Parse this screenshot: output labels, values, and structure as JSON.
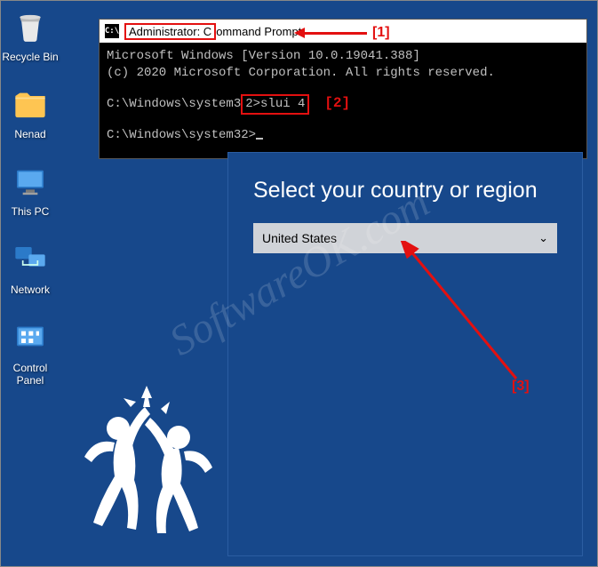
{
  "desktop": {
    "icons": [
      {
        "label": "Recycle Bin"
      },
      {
        "label": "Nenad"
      },
      {
        "label": "This PC"
      },
      {
        "label": "Network"
      },
      {
        "label": "Control Panel"
      }
    ]
  },
  "cmd": {
    "title_prefix": "Administrator: C",
    "title_suffix": "ommand Prompt",
    "line1": "Microsoft Windows [Version 10.0.19041.388]",
    "line2": "(c) 2020 Microsoft Corporation. All rights reserved.",
    "prompt1_pre": "C:\\Windows\\system3",
    "prompt1_boxed": "2>slui 4",
    "prompt2": "C:\\Windows\\system32>"
  },
  "annotations": {
    "a1": "[1]",
    "a2": "[2]",
    "a3": "[3]"
  },
  "dialog": {
    "heading": "Select your country or region",
    "selected": "United States"
  },
  "watermark": "SoftwareOK.com"
}
